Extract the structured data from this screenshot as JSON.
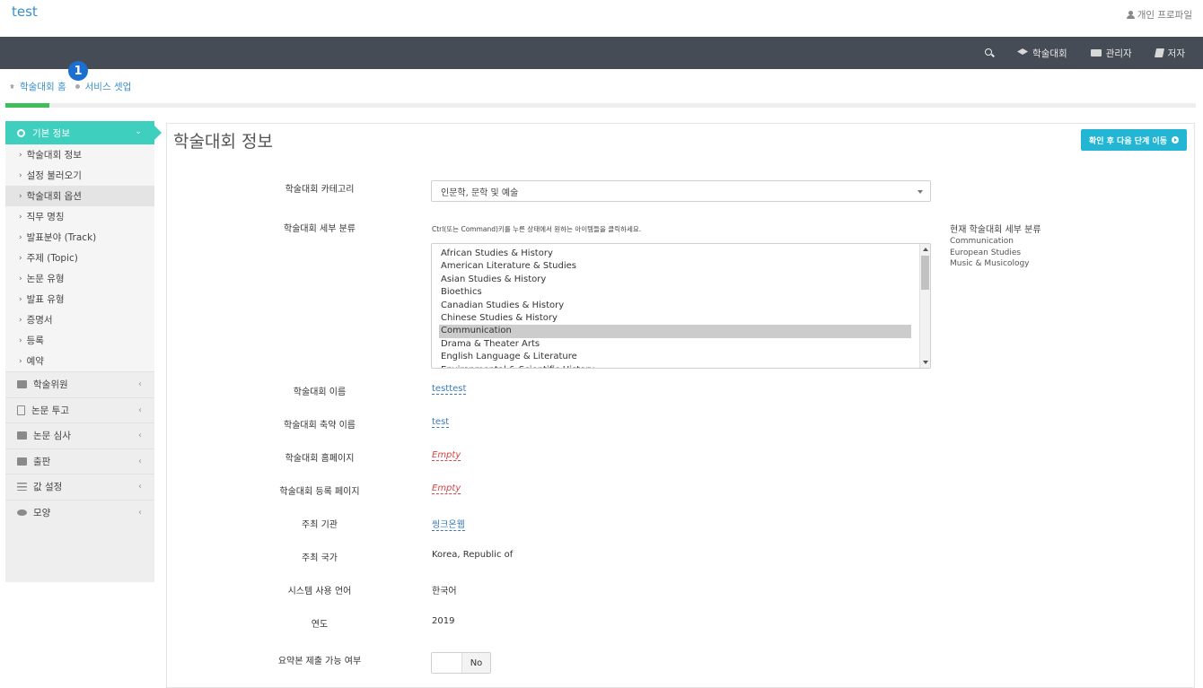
{
  "app": {
    "brand": "test",
    "profile_label": "개인 프로파일"
  },
  "nav": {
    "items": [
      {
        "name": "nav-conference",
        "icon": "graduation-cap-icon",
        "label": "학술대회"
      },
      {
        "name": "nav-admin",
        "icon": "list-icon",
        "label": "관리자"
      },
      {
        "name": "nav-author",
        "icon": "book-icon",
        "label": "저자"
      }
    ]
  },
  "breadcrumb": {
    "home": "학술대회 홈",
    "current": "서비스 셋업",
    "step_badge": "1"
  },
  "progress": {
    "fill_fraction": 0.037
  },
  "sidebar": {
    "section_title": "기본 정보",
    "sub_items": [
      "학술대회 정보",
      "설정 불러오기",
      "학술대회 옵션",
      "직무 명칭",
      "발표분야 (Track)",
      "주제 (Topic)",
      "논문 유형",
      "발표 유형",
      "증명서",
      "등록",
      "예약"
    ],
    "menu_items": [
      {
        "label": "학술위원",
        "icon": "briefcase-icon"
      },
      {
        "label": "논문 투고",
        "icon": "document-icon"
      },
      {
        "label": "논문 심사",
        "icon": "edit-icon"
      },
      {
        "label": "출판",
        "icon": "book-icon"
      },
      {
        "label": "값 설정",
        "icon": "sliders-icon"
      },
      {
        "label": "모양",
        "icon": "eye-icon"
      }
    ]
  },
  "main": {
    "title": "학술대회 정보",
    "next_button": "확인 후 다음 단계 이동",
    "category_label": "학술대회 카테고리",
    "category_value": "인문학, 문학 및 예술",
    "subcategory_label": "학술대회 세부 분류",
    "subcategory_hint": "Ctrl(또는 Command)키를 누른 상태에서 원하는 아이템들을 클릭하세요.",
    "subcategory_options": [
      "African Studies & History",
      "American Literature & Studies",
      "Asian Studies & History",
      "Bioethics",
      "Canadian Studies & History",
      "Chinese Studies & History",
      "Communication",
      "Drama & Theater Arts",
      "English Language & Literature",
      "Environmental & Scientific History"
    ],
    "subcategory_selected": "Communication",
    "current_title": "현재 학술대회 세부 분류",
    "current_items": [
      "Communication",
      "European Studies",
      "Music & Musicology"
    ],
    "fields": [
      {
        "label": "학술대회 이름",
        "value": "testtest",
        "style": "editable"
      },
      {
        "label": "학술대회 축약 이름",
        "value": "test",
        "style": "editable"
      },
      {
        "label": "학술대회 홈페이지",
        "value": "Empty",
        "style": "empty"
      },
      {
        "label": "학술대회 등록 페이지",
        "value": "Empty",
        "style": "empty"
      },
      {
        "label": "주최 기관",
        "value": "씽크온웹",
        "style": "editable"
      },
      {
        "label": "주최 국가",
        "value": "Korea, Republic of",
        "style": "plain"
      },
      {
        "label": "시스템 사용 언어",
        "value": "한국어",
        "style": "plain"
      },
      {
        "label": "연도",
        "value": "2019",
        "style": "plain"
      }
    ],
    "abstract_label": "요약본 제출 가능 여부",
    "abstract_toggle": "No"
  }
}
